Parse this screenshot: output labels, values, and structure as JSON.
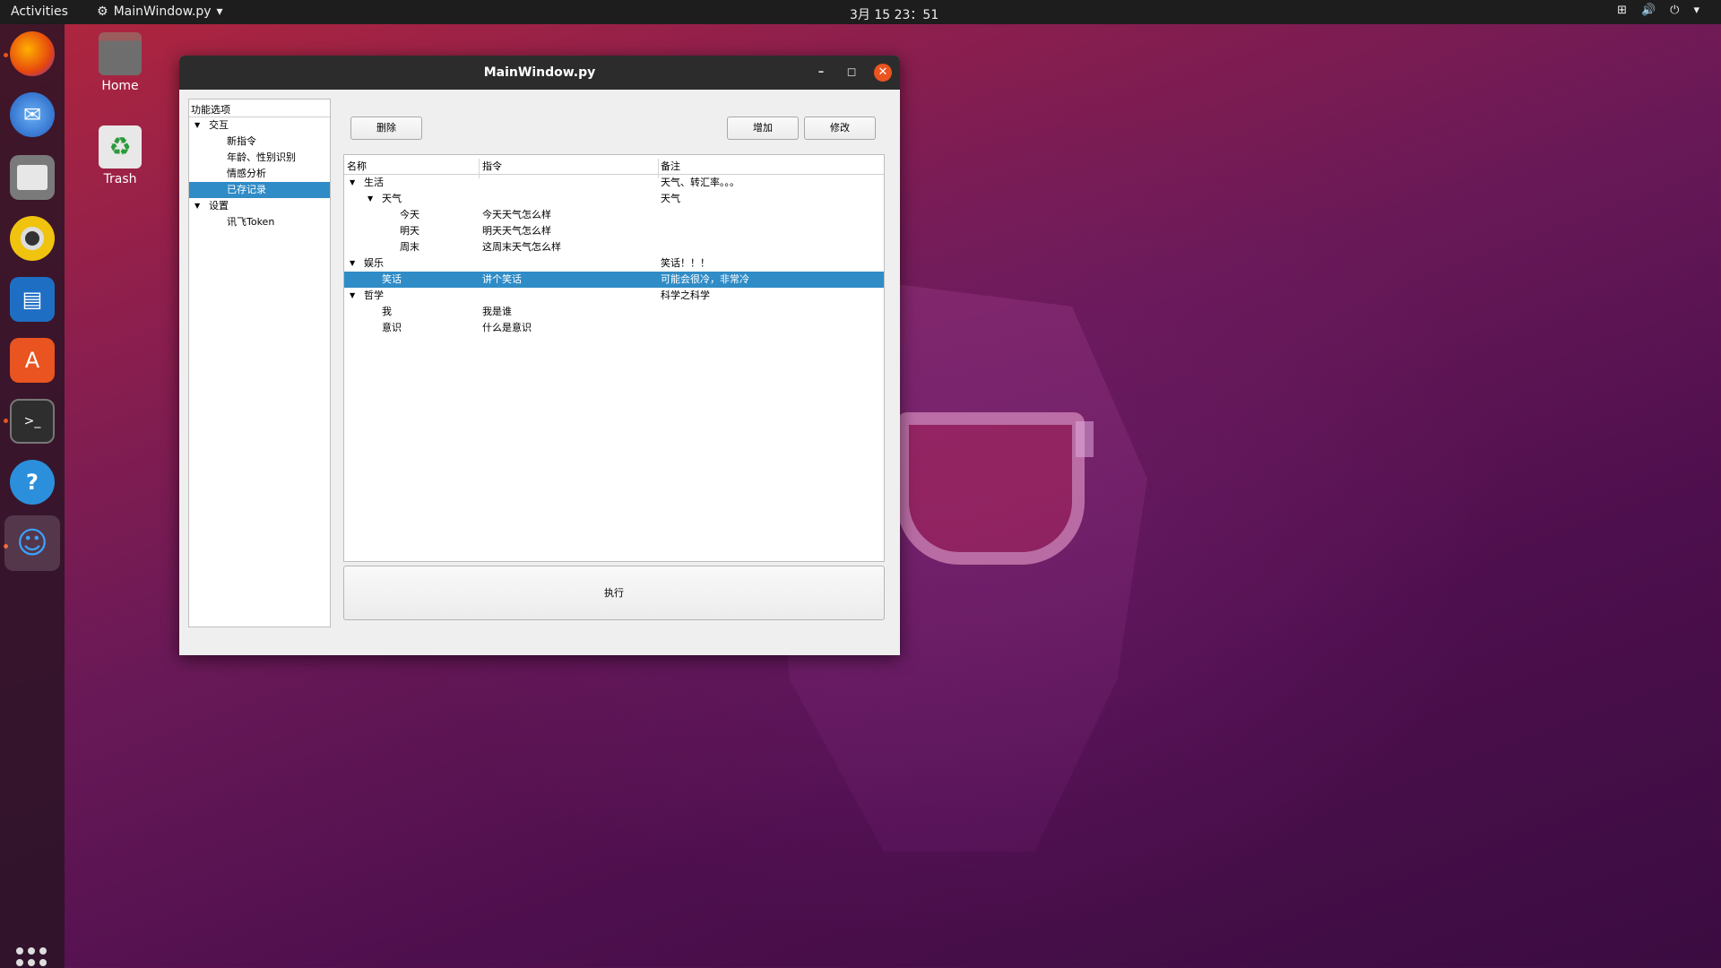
{
  "topbar": {
    "activities": "Activities",
    "app_name": "MainWindow.py",
    "clock": "3月 15  23：51"
  },
  "desktop": {
    "home_label": "Home",
    "trash_label": "Trash"
  },
  "window": {
    "title": "MainWindow.py"
  },
  "left_panel": {
    "header": "功能选项",
    "items": [
      {
        "label": "交互",
        "level": 0,
        "expanded": true
      },
      {
        "label": "新指令",
        "level": 1
      },
      {
        "label": "年龄、性别识别",
        "level": 1
      },
      {
        "label": "情感分析",
        "level": 1
      },
      {
        "label": "已存记录",
        "level": 1,
        "selected": true
      },
      {
        "label": "设置",
        "level": 0,
        "expanded": true
      },
      {
        "label": "讯飞Token",
        "level": 1
      }
    ]
  },
  "toolbar": {
    "delete_label": "删除",
    "add_label": "增加",
    "edit_label": "修改"
  },
  "table": {
    "columns": [
      "名称",
      "指令",
      "备注"
    ],
    "rows": [
      {
        "name": "生活",
        "command": "",
        "note": "天气、转汇率。。。",
        "level": 0,
        "expandable": true
      },
      {
        "name": "天气",
        "command": "",
        "note": "天气",
        "level": 1,
        "expandable": true
      },
      {
        "name": "今天",
        "command": "今天天气怎么样",
        "note": "",
        "level": 2
      },
      {
        "name": "明天",
        "command": "明天天气怎么样",
        "note": "",
        "level": 2
      },
      {
        "name": "周末",
        "command": "这周末天气怎么样",
        "note": "",
        "level": 2
      },
      {
        "name": "娱乐",
        "command": "",
        "note": "笑话！！！",
        "level": 0,
        "expandable": true
      },
      {
        "name": "笑话",
        "command": "讲个笑话",
        "note": "可能会很冷，非常冷",
        "level": 1,
        "selected": true
      },
      {
        "name": "哲学",
        "command": "",
        "note": "科学之科学",
        "level": 0,
        "expandable": true
      },
      {
        "name": "我",
        "command": "我是谁",
        "note": "",
        "level": 1
      },
      {
        "name": "意识",
        "command": "什么是意识",
        "note": "",
        "level": 1
      }
    ]
  },
  "execute_label": "执行",
  "colors": {
    "selection": "#308cc6",
    "ubuntu_orange": "#e95420",
    "titlebar": "#2c2c2c"
  }
}
